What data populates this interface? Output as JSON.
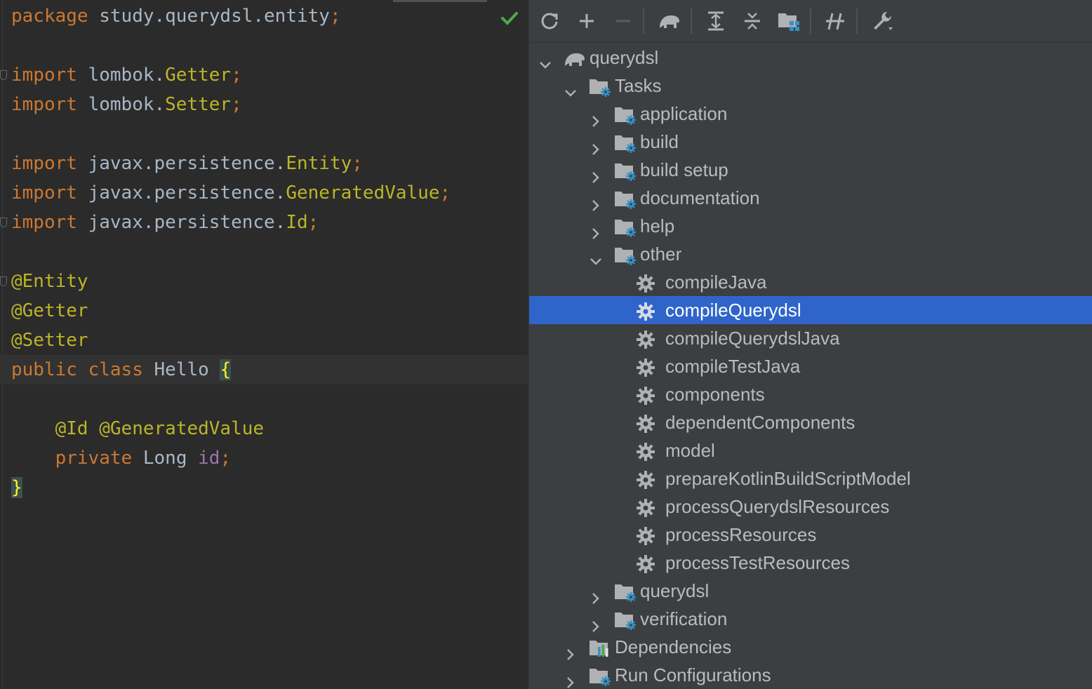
{
  "editor": {
    "lines": [
      [
        {
          "t": "package",
          "c": "kw"
        },
        {
          "t": " study.querydsl.entity",
          "c": "cls"
        },
        {
          "t": ";",
          "c": "semi"
        }
      ],
      [],
      [
        {
          "t": "import",
          "c": "kw"
        },
        {
          "t": " lombok.",
          "c": "cls"
        },
        {
          "t": "Getter",
          "c": "ann"
        },
        {
          "t": ";",
          "c": "semi"
        }
      ],
      [
        {
          "t": "import",
          "c": "kw"
        },
        {
          "t": " lombok.",
          "c": "cls"
        },
        {
          "t": "Setter",
          "c": "ann"
        },
        {
          "t": ";",
          "c": "semi"
        }
      ],
      [],
      [
        {
          "t": "import",
          "c": "kw"
        },
        {
          "t": " javax.persistence.",
          "c": "cls"
        },
        {
          "t": "Entity",
          "c": "ann"
        },
        {
          "t": ";",
          "c": "semi"
        }
      ],
      [
        {
          "t": "import",
          "c": "kw"
        },
        {
          "t": " javax.persistence.",
          "c": "cls"
        },
        {
          "t": "GeneratedValue",
          "c": "ann"
        },
        {
          "t": ";",
          "c": "semi"
        }
      ],
      [
        {
          "t": "import",
          "c": "kw"
        },
        {
          "t": " javax.persistence.",
          "c": "cls"
        },
        {
          "t": "Id",
          "c": "ann"
        },
        {
          "t": ";",
          "c": "semi"
        }
      ],
      [],
      [
        {
          "t": "@Entity",
          "c": "ann"
        }
      ],
      [
        {
          "t": "@Getter",
          "c": "ann"
        }
      ],
      [
        {
          "t": "@Setter",
          "c": "ann"
        }
      ],
      [
        {
          "t": "public",
          "c": "kw"
        },
        {
          "t": " ",
          "c": "cls"
        },
        {
          "t": "class",
          "c": "kw"
        },
        {
          "t": " Hello ",
          "c": "cls"
        },
        {
          "t": "{",
          "c": "brace-hl"
        }
      ],
      [],
      [
        {
          "t": "    ",
          "c": "cls"
        },
        {
          "t": "@Id",
          "c": "ann"
        },
        {
          "t": " ",
          "c": "cls"
        },
        {
          "t": "@GeneratedValue",
          "c": "ann"
        }
      ],
      [
        {
          "t": "    ",
          "c": "cls"
        },
        {
          "t": "private",
          "c": "kw"
        },
        {
          "t": " Long ",
          "c": "cls"
        },
        {
          "t": "id",
          "c": "field"
        },
        {
          "t": ";",
          "c": "semi"
        }
      ],
      [
        {
          "t": "}",
          "c": "brace-hl"
        }
      ]
    ],
    "status_icon": "check-icon",
    "colors": {
      "keyword": "#cc7832",
      "annotation": "#bbb529",
      "text": "#a9b7c6",
      "field": "#9876aa",
      "check": "#4fa74b"
    }
  },
  "toolbar": {
    "buttons": [
      {
        "name": "reload-all-gradle-projects-button",
        "icon": "refresh-icon"
      },
      {
        "name": "link-gradle-project-button",
        "icon": "plus-icon"
      },
      {
        "name": "unlink-gradle-project-button",
        "icon": "minus-icon"
      },
      {
        "name": "execute-gradle-task-button",
        "icon": "elephant-icon"
      },
      {
        "name": "expand-all-button",
        "icon": "expand-all-icon"
      },
      {
        "name": "collapse-all-button",
        "icon": "collapse-all-icon"
      },
      {
        "name": "group-modules-button",
        "icon": "folder-group-icon"
      },
      {
        "name": "toggle-offline-mode-button",
        "icon": "offline-icon"
      },
      {
        "name": "build-tool-settings-button",
        "icon": "wrench-icon"
      }
    ]
  },
  "tree": [
    {
      "label": "querydsl",
      "depth": 0,
      "icon": "gradle-elephant-icon",
      "chevron": "down",
      "name": "tree-item-project-querydsl"
    },
    {
      "label": "Tasks",
      "depth": 1,
      "icon": "task-folder-icon",
      "chevron": "down",
      "name": "tree-item-tasks"
    },
    {
      "label": "application",
      "depth": 2,
      "icon": "task-folder-icon",
      "chevron": "right",
      "name": "tree-item-application"
    },
    {
      "label": "build",
      "depth": 2,
      "icon": "task-folder-icon",
      "chevron": "right",
      "name": "tree-item-build"
    },
    {
      "label": "build setup",
      "depth": 2,
      "icon": "task-folder-icon",
      "chevron": "right",
      "name": "tree-item-build-setup"
    },
    {
      "label": "documentation",
      "depth": 2,
      "icon": "task-folder-icon",
      "chevron": "right",
      "name": "tree-item-documentation"
    },
    {
      "label": "help",
      "depth": 2,
      "icon": "task-folder-icon",
      "chevron": "right",
      "name": "tree-item-help"
    },
    {
      "label": "other",
      "depth": 2,
      "icon": "task-folder-icon",
      "chevron": "down",
      "name": "tree-item-other"
    },
    {
      "label": "compileJava",
      "depth": 3,
      "icon": "gear-icon",
      "chevron": "none",
      "name": "task-compilejava"
    },
    {
      "label": "compileQuerydsl",
      "depth": 3,
      "icon": "gear-icon",
      "chevron": "none",
      "name": "task-compilequerydsl",
      "selected": true
    },
    {
      "label": "compileQuerydslJava",
      "depth": 3,
      "icon": "gear-icon",
      "chevron": "none",
      "name": "task-compilequerydsljava"
    },
    {
      "label": "compileTestJava",
      "depth": 3,
      "icon": "gear-icon",
      "chevron": "none",
      "name": "task-compiletestjava"
    },
    {
      "label": "components",
      "depth": 3,
      "icon": "gear-icon",
      "chevron": "none",
      "name": "task-components"
    },
    {
      "label": "dependentComponents",
      "depth": 3,
      "icon": "gear-icon",
      "chevron": "none",
      "name": "task-dependentcomponents"
    },
    {
      "label": "model",
      "depth": 3,
      "icon": "gear-icon",
      "chevron": "none",
      "name": "task-model"
    },
    {
      "label": "prepareKotlinBuildScriptModel",
      "depth": 3,
      "icon": "gear-icon",
      "chevron": "none",
      "name": "task-preparekotlinbuildscriptmodel"
    },
    {
      "label": "processQuerydslResources",
      "depth": 3,
      "icon": "gear-icon",
      "chevron": "none",
      "name": "task-processquerydslresources"
    },
    {
      "label": "processResources",
      "depth": 3,
      "icon": "gear-icon",
      "chevron": "none",
      "name": "task-processresources"
    },
    {
      "label": "processTestResources",
      "depth": 3,
      "icon": "gear-icon",
      "chevron": "none",
      "name": "task-processtestresources"
    },
    {
      "label": "querydsl",
      "depth": 2,
      "icon": "task-folder-icon",
      "chevron": "right",
      "name": "tree-item-querydsl-group"
    },
    {
      "label": "verification",
      "depth": 2,
      "icon": "task-folder-icon",
      "chevron": "right",
      "name": "tree-item-verification"
    },
    {
      "label": "Dependencies",
      "depth": 1,
      "icon": "dependencies-folder-icon",
      "chevron": "right",
      "name": "tree-item-dependencies"
    },
    {
      "label": "Run Configurations",
      "depth": 1,
      "icon": "task-folder-icon",
      "chevron": "right",
      "name": "tree-item-run-configurations"
    }
  ],
  "colors": {
    "panel_bg": "#3c3f41",
    "editor_bg": "#2b2b2b",
    "selection": "#2f65ca",
    "tree_text": "#bbbbbb",
    "icon_blue": "#3592c4",
    "icon_gray": "#afb1b3"
  }
}
